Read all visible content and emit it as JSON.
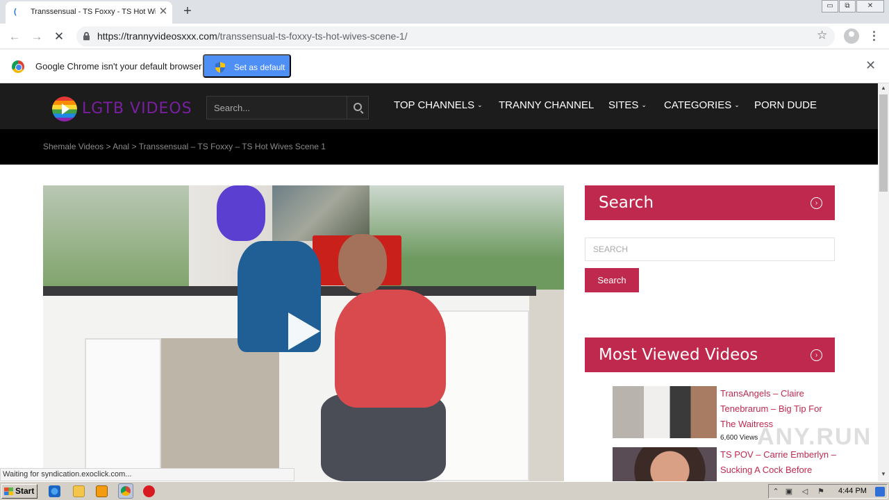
{
  "browser": {
    "tab_title": "Transsensual - TS Foxxy - TS Hot Wi",
    "tab_close": "✕",
    "new_tab": "+",
    "url_host": "https://trannyvideosxxx.com",
    "url_path": "/transsensual-ts-foxxy-ts-hot-wives-scene-1/",
    "back_icon": "←",
    "forward_icon": "→",
    "stop_icon": "✕",
    "star_icon": "☆",
    "menu_icon": "⋮",
    "win_min": "▭",
    "win_max": "⧉",
    "win_close": "✕"
  },
  "infobar": {
    "message": "Google Chrome isn't your default browser",
    "button": "Set as default",
    "close": "✕"
  },
  "site": {
    "logo": "LGTB VIDEOS",
    "search_placeholder": "Search...",
    "nav": [
      {
        "label": "TOP CHANNELS",
        "chevron": "⌄"
      },
      {
        "label": "TRANNY CHANNEL"
      },
      {
        "label": "SITES",
        "chevron": "⌄"
      },
      {
        "label": "CATEGORIES",
        "chevron": "⌄"
      },
      {
        "label": "PORN DUDE"
      }
    ],
    "breadcrumb": [
      "Shemale Videos",
      ">",
      "Anal",
      ">",
      "Transsensual – TS Foxxy – TS Hot Wives Scene 1"
    ]
  },
  "sidebar": {
    "search_title": "Search",
    "search_placeholder": "SEARCH",
    "search_button": "Search",
    "most_viewed_title": "Most Viewed Videos",
    "arrow": "›",
    "videos": [
      {
        "title": "TransAngels – Claire Tenebrarum – Big Tip For The Waitress",
        "views": "6,600 Views"
      },
      {
        "title": "TS POV – Carrie Emberlyn – Sucking A Cock Before",
        "views": ""
      }
    ]
  },
  "status_text": "Waiting for syndication.exoclick.com...",
  "watermark": "ANY.RUN",
  "taskbar": {
    "start": "Start",
    "clock": "4:44 PM"
  },
  "colors": {
    "accent": "#c0294e",
    "header_bg": "#1c1c1c",
    "logo": "#7b1fa2",
    "chrome_button": "#4d8ff5"
  }
}
